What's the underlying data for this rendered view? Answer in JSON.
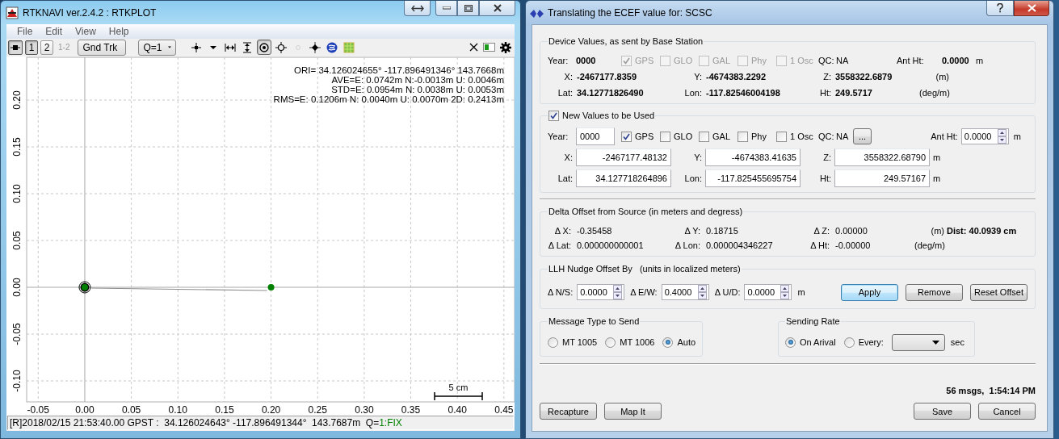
{
  "plot_window": {
    "title": "RTKNAVI ver.2.4.2 : RTKPLOT",
    "menu": [
      {
        "label": "File"
      },
      {
        "label": "Edit"
      },
      {
        "label": "View"
      },
      {
        "label": "Help"
      }
    ],
    "toolbar": {
      "plot_buttons": [
        {
          "kind": "icon",
          "selected": true,
          "disabled": false
        },
        {
          "kind": "text",
          "label": "1",
          "selected": true,
          "disabled": false
        },
        {
          "kind": "text",
          "label": "2",
          "selected": false,
          "disabled": false
        },
        {
          "kind": "text",
          "label": "1-2",
          "selected": false,
          "disabled": true
        }
      ],
      "plot_type": "Gnd Trk",
      "quality": "Q=1",
      "tools": [
        {
          "kind": "crosshair",
          "selected": false,
          "disabled": false
        },
        {
          "kind": "caret",
          "selected": false,
          "disabled": false
        },
        {
          "kind": "fit-horizontal",
          "selected": false,
          "disabled": false
        },
        {
          "kind": "fit-vertical",
          "selected": false,
          "disabled": false
        },
        {
          "kind": "target",
          "selected": true,
          "disabled": false
        },
        {
          "kind": "crosshair-circle",
          "selected": false,
          "disabled": false
        },
        {
          "kind": "small-circle",
          "selected": false,
          "disabled": true
        },
        {
          "kind": "dot",
          "selected": false,
          "disabled": false
        },
        {
          "kind": "globe",
          "selected": false,
          "disabled": false
        },
        {
          "kind": "map",
          "selected": false,
          "disabled": false
        }
      ]
    },
    "stats": [
      "ORI= 34.126024655° -117.896491346° 143.7668m",
      "AVE=E: 0.0742m N:-0.0013m U: 0.0046m",
      "STD=E: 0.0954m N: 0.0038m U: 0.0053m",
      "RMS=E: 0.1206m N: 0.0040m U: 0.0070m 2D: 0.2413m"
    ],
    "scale_label": "5 cm",
    "chart_data": {
      "type": "scatter",
      "x": [
        0.0,
        0.2
      ],
      "series": [
        {
          "color": "#008000",
          "values": [
            0.0,
            0.0
          ]
        }
      ],
      "grid": true,
      "xlim": [
        -0.0624,
        0.4614
      ],
      "ylim": [
        -0.1224,
        0.2457
      ],
      "xticks": [
        {
          "value": -0.05,
          "label": "-0.05"
        },
        {
          "value": 0,
          "label": "0.00"
        },
        {
          "value": 0.05,
          "label": "0.05"
        },
        {
          "value": 0.1,
          "label": "0.10"
        },
        {
          "value": 0.15,
          "label": "0.15"
        },
        {
          "value": 0.2,
          "label": "0.20"
        },
        {
          "value": 0.25,
          "label": "0.25"
        },
        {
          "value": 0.3,
          "label": "0.30"
        },
        {
          "value": 0.35,
          "label": "0.35"
        },
        {
          "value": 0.4,
          "label": "0.40"
        },
        {
          "value": 0.45,
          "label": "0.45"
        }
      ],
      "yticks": [
        {
          "value": -0.1,
          "label": "-0.10"
        },
        {
          "value": -0.05,
          "label": "-0.05"
        },
        {
          "value": 0,
          "label": "0.00"
        },
        {
          "value": 0.05,
          "label": "0.05"
        },
        {
          "value": 0.1,
          "label": "0.10"
        },
        {
          "value": 0.15,
          "label": "0.15"
        },
        {
          "value": 0.2,
          "label": "0.20"
        }
      ]
    },
    "status": {
      "text": "[R]2018/02/15 21:53:40.00 GPST :  34.126024643° -117.896491344°  143.7687m  Q=",
      "quality": "1:FIX"
    }
  },
  "dialog": {
    "title": "Translating the ECEF value for: SCSC",
    "device": {
      "legend": "Device Values, as sent by Base Station",
      "year_label": "Year:",
      "year": "0000",
      "systems": [
        {
          "label": "GPS",
          "checked": true,
          "disabled": true
        },
        {
          "label": "GLO",
          "checked": false,
          "disabled": true
        },
        {
          "label": "GAL",
          "checked": false,
          "disabled": true
        },
        {
          "label": "Phy",
          "checked": false,
          "disabled": true
        },
        {
          "label": "1 Osc",
          "checked": false,
          "disabled": true
        }
      ],
      "qc_label": "QC:",
      "qc": "NA",
      "ant_label": "Ant Ht:",
      "ant": "0.0000",
      "ant_unit": "m",
      "rows": [
        {
          "cells": [
            {
              "label": "X:",
              "value": "-2467177.8359"
            },
            {
              "label": "Y:",
              "value": "-4674383.2292"
            },
            {
              "label": "Z:",
              "value": "3558322.6879"
            }
          ],
          "unit": "(m)"
        },
        {
          "cells": [
            {
              "label": "Lat:",
              "value": "34.12771826490"
            },
            {
              "label": "Lon:",
              "value": "-117.82546004198"
            },
            {
              "label": "Ht:",
              "value": "249.5717"
            }
          ],
          "unit": "(deg/m)"
        }
      ]
    },
    "new_values": {
      "legend": "New Values to be Used",
      "checked": true,
      "year_label": "Year:",
      "year": "0000",
      "systems": [
        {
          "label": "GPS",
          "checked": true,
          "disabled": false
        },
        {
          "label": "GLO",
          "checked": false,
          "disabled": false
        },
        {
          "label": "GAL",
          "checked": false,
          "disabled": false
        },
        {
          "label": "Phy",
          "checked": false,
          "disabled": false
        },
        {
          "label": "1 Osc",
          "checked": false,
          "disabled": false
        }
      ],
      "qc_label": "QC:",
      "qc": "NA",
      "more_button": "...",
      "ant_label": "Ant Ht:",
      "ant": "0.0000",
      "ant_unit": "m",
      "rows": [
        {
          "cells": [
            {
              "label": "X:",
              "value": "-2467177.48132"
            },
            {
              "label": "Y:",
              "value": "-4674383.41635"
            },
            {
              "label": "Z:",
              "value": "3558322.68790"
            }
          ],
          "unit": "m"
        },
        {
          "cells": [
            {
              "label": "Lat:",
              "value": "34.127718264896"
            },
            {
              "label": "Lon:",
              "value": "-117.825455695754"
            },
            {
              "label": "Ht:",
              "value": "249.57167"
            }
          ],
          "unit": "m"
        }
      ]
    },
    "delta": {
      "legend": "Delta Offset from Source (in meters and degress)",
      "rows": [
        {
          "cells": [
            {
              "label": "Δ X:",
              "value": "-0.35458"
            },
            {
              "label": "Δ Y:",
              "value": "0.18715"
            },
            {
              "label": "Δ Z:",
              "value": "0.00000"
            }
          ],
          "unit": "(m)"
        },
        {
          "cells": [
            {
              "label": "Δ Lat:",
              "value": "0.000000000001"
            },
            {
              "label": "Δ Lon:",
              "value": "0.000004346227"
            },
            {
              "label": "Δ Ht:",
              "value": "-0.00000"
            }
          ],
          "unit": "(deg/m)"
        }
      ],
      "dist_label": "Dist:",
      "dist": "40.0939 cm"
    },
    "nudge": {
      "legend": "LLH Nudge Offset By   (units in localized meters)",
      "fields": [
        {
          "label": "Δ N/S:",
          "value": "0.0000"
        },
        {
          "label": "Δ E/W:",
          "value": "0.4000"
        },
        {
          "label": "Δ U/D:",
          "value": "0.0000"
        }
      ],
      "unit": "m",
      "buttons": [
        {
          "label": "Apply",
          "default": true
        },
        {
          "label": "Remove",
          "default": false
        },
        {
          "label": "Reset Offset",
          "default": false
        }
      ]
    },
    "message_type": {
      "legend": "Message Type to Send",
      "options": [
        {
          "label": "MT 1005",
          "selected": false
        },
        {
          "label": "MT 1006",
          "selected": false
        },
        {
          "label": "Auto",
          "selected": true
        }
      ]
    },
    "sending_rate": {
      "legend": "Sending Rate",
      "options": [
        {
          "label": "On Arival",
          "selected": true
        },
        {
          "label": "Every:",
          "selected": false
        }
      ],
      "unit": "sec"
    },
    "status": "56 msgs,  1:54:14 PM",
    "left_buttons": [
      {
        "label": "Recapture"
      },
      {
        "label": "Map It"
      }
    ],
    "right_buttons": [
      {
        "label": "Save"
      },
      {
        "label": "Cancel"
      }
    ]
  }
}
